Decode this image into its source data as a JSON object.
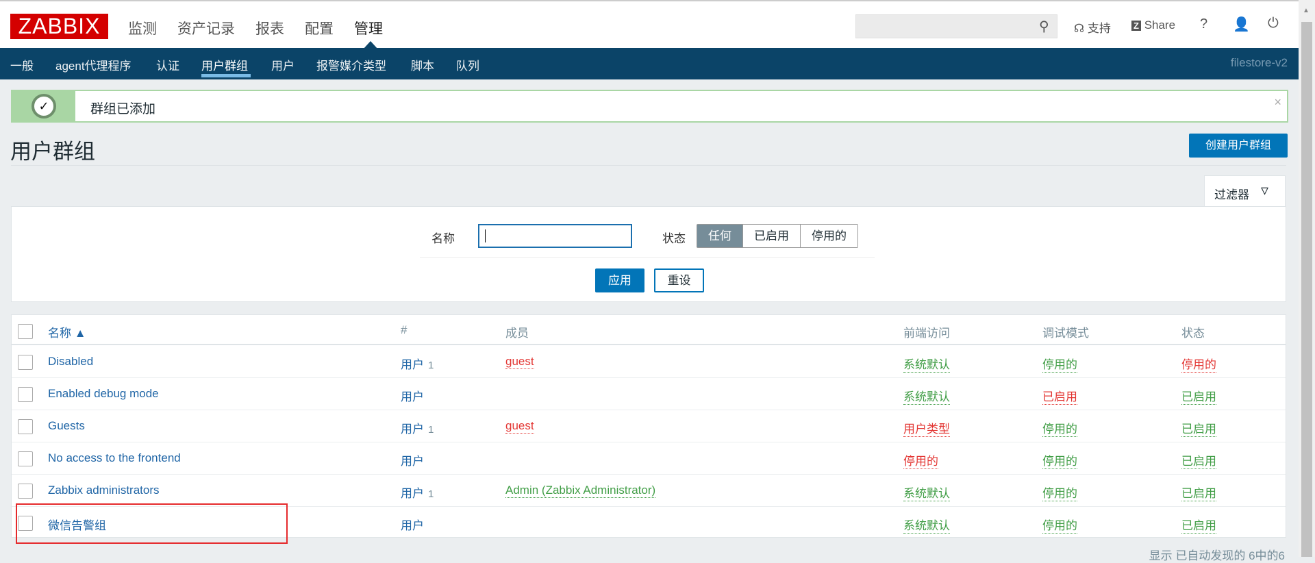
{
  "header": {
    "logo": "ZABBIX",
    "menu": [
      "监测",
      "资产记录",
      "报表",
      "配置",
      "管理"
    ],
    "active_menu": "管理",
    "search_placeholder": "",
    "support": "支持",
    "share": "Share",
    "help": "?"
  },
  "subnav": {
    "items": [
      "一般",
      "agent代理程序",
      "认证",
      "用户群组",
      "用户",
      "报警媒介类型",
      "脚本",
      "队列"
    ],
    "active": "用户群组",
    "host": "filestore-v2"
  },
  "message": {
    "text": "群组已添加",
    "close": "×"
  },
  "page": {
    "title": "用户群组",
    "create_button": "创建用户群组"
  },
  "filter": {
    "tab_label": "过滤器",
    "name_label": "名称",
    "name_value": "",
    "status_label": "状态",
    "status_options": [
      "任何",
      "已启用",
      "停用的"
    ],
    "status_selected": "任何",
    "apply": "应用",
    "reset": "重设"
  },
  "table": {
    "headers": {
      "name": "名称 ▲",
      "count": "#",
      "members": "成员",
      "frontend": "前端访问",
      "debug": "调试模式",
      "status": "状态"
    },
    "rows": [
      {
        "name": "Disabled",
        "users": "用户",
        "count": "1",
        "members": "guest",
        "frontend": "系统默认",
        "debug": "停用的",
        "status": "停用的"
      },
      {
        "name": "Enabled debug mode",
        "users": "用户",
        "count": "",
        "members": "",
        "frontend": "系统默认",
        "debug": "已启用",
        "status": "已启用"
      },
      {
        "name": "Guests",
        "users": "用户",
        "count": "1",
        "members": "guest",
        "frontend": "用户类型",
        "debug": "停用的",
        "status": "已启用"
      },
      {
        "name": "No access to the frontend",
        "users": "用户",
        "count": "",
        "members": "",
        "frontend": "停用的",
        "debug": "停用的",
        "status": "已启用"
      },
      {
        "name": "Zabbix administrators",
        "users": "用户",
        "count": "1",
        "members": "Admin (Zabbix Administrator)",
        "frontend": "系统默认",
        "debug": "停用的",
        "status": "已启用"
      },
      {
        "name": "微信告警组",
        "users": "用户",
        "count": "",
        "members": "",
        "frontend": "系统默认",
        "debug": "停用的",
        "status": "已启用"
      }
    ],
    "footer": "显示 已自动发现的 6中的6"
  },
  "colors": {
    "brand": "#d40000",
    "nav": "#0b4468",
    "primary": "#0275b8",
    "green": "#429e47",
    "red": "#e33734"
  }
}
